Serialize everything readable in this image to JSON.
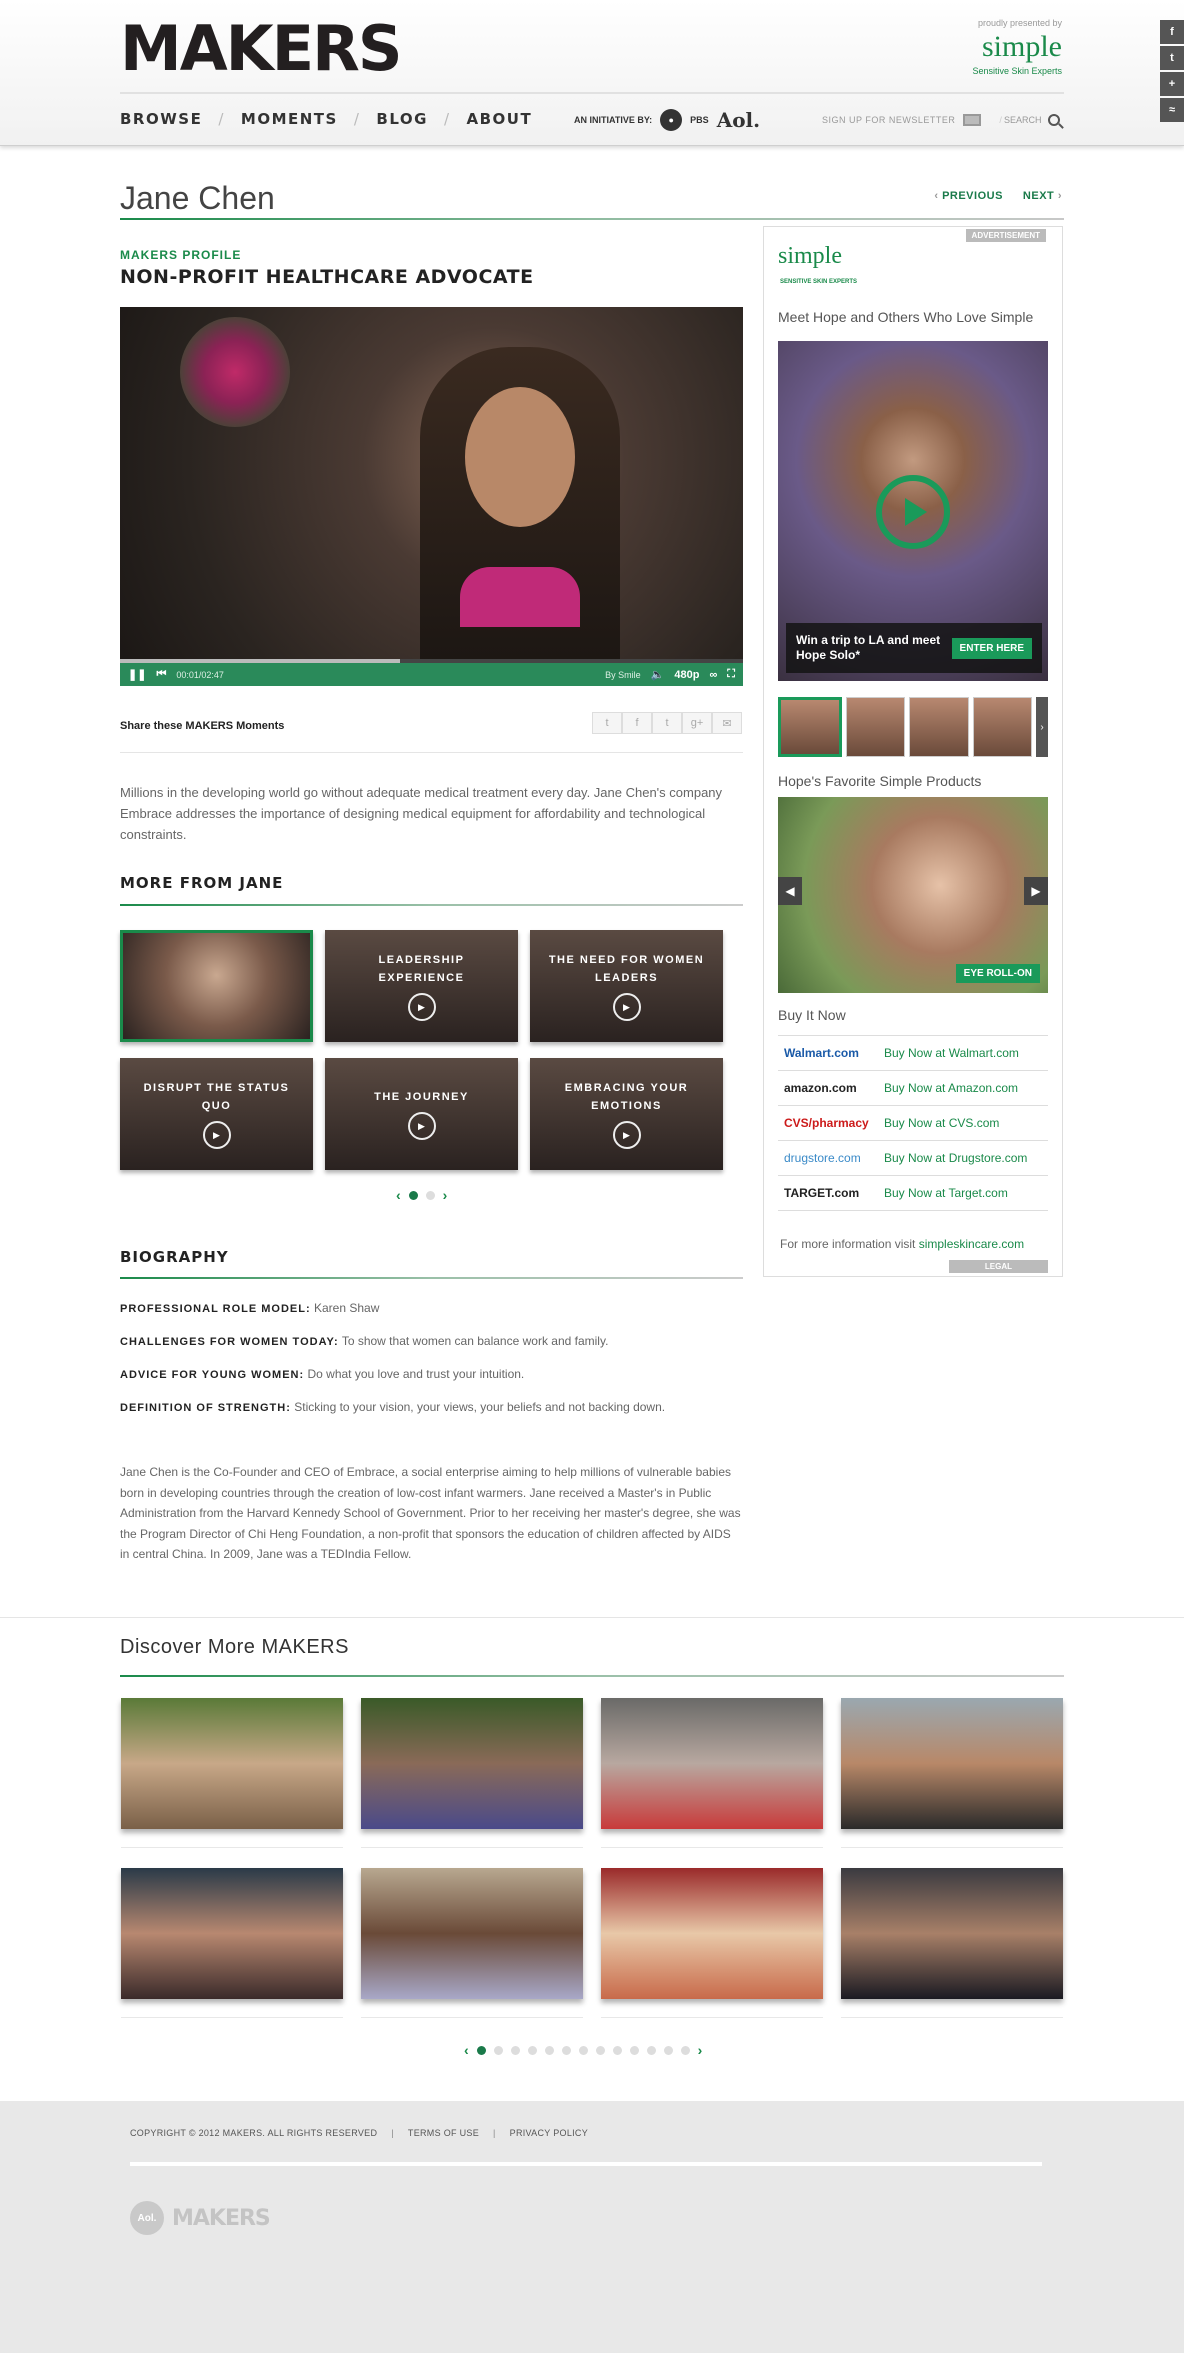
{
  "header": {
    "logo": "MAKERS",
    "presented_by": "proudly presented by",
    "sponsor_brand": "simple",
    "sponsor_tagline": "Sensitive Skin Experts",
    "nav": [
      "BROWSE",
      "MOMENTS",
      "BLOG",
      "ABOUT"
    ],
    "initiative_label": "AN INITIATIVE BY:",
    "pbs": "PBS",
    "aol": "Aol.",
    "newsletter": "SIGN UP FOR NEWSLETTER",
    "search": "SEARCH",
    "social_rail": [
      "f",
      "t",
      "+",
      "rss"
    ]
  },
  "profile": {
    "name": "Jane Chen",
    "previous": "PREVIOUS",
    "next": "NEXT",
    "kicker": "MAKERS PROFILE",
    "role": "NON-PROFIT HEALTHCARE ADVOCATE",
    "video": {
      "time": "00:01/02:47",
      "by": "By Smile",
      "quality": "480p"
    },
    "share_label": "Share these MAKERS Moments",
    "intro": "Millions in the developing world go without adequate medical treatment every day. Jane Chen's company Embrace addresses the importance of designing medical equipment for affordability and technological constraints."
  },
  "more_from": {
    "title": "MORE FROM JANE",
    "items": [
      "",
      "LEADERSHIP EXPERIENCE",
      "THE NEED FOR WOMEN LEADERS",
      "DISRUPT THE STATUS QUO",
      "THE JOURNEY",
      "EMBRACING YOUR EMOTIONS"
    ]
  },
  "biography": {
    "title": "BIOGRAPHY",
    "lines": [
      {
        "label": "PROFESSIONAL ROLE MODEL:",
        "value": "Karen Shaw"
      },
      {
        "label": "CHALLENGES FOR WOMEN TODAY:",
        "value": "To show that women can balance work and family."
      },
      {
        "label": "ADVICE FOR YOUNG WOMEN:",
        "value": "Do what you love and trust your intuition."
      },
      {
        "label": "DEFINITION OF STRENGTH:",
        "value": "Sticking to your vision, your views, your beliefs and not backing down."
      }
    ],
    "text": "Jane Chen is the Co-Founder and CEO of Embrace, a social enterprise aiming to help millions of vulnerable babies born in developing countries through the creation of low-cost infant warmers. Jane received a Master's in Public Administration from the Harvard Kennedy School of Government. Prior to her receiving her master's degree, she was the Program Director of Chi Heng Foundation, a non-profit that sponsors the education of children affected by AIDS in central China. In 2009, Jane was a TEDIndia Fellow."
  },
  "ad": {
    "tag": "ADVERTISEMENT",
    "brand": "simple",
    "brand_sub": "SENSITIVE SKIN EXPERTS",
    "headline": "Meet Hope and Others Who Love Simple",
    "promo_text": "Win a trip to LA and meet Hope Solo*",
    "promo_button": "ENTER HERE",
    "favorites_title": "Hope's Favorite Simple Products",
    "product_button": "EYE ROLL-ON",
    "buy_title": "Buy It Now",
    "retailers": [
      {
        "logo": "Walmart.com",
        "link": "Buy Now at Walmart.com",
        "color": "#1a5aa8"
      },
      {
        "logo": "amazon.com",
        "link": "Buy Now at Amazon.com",
        "color": "#222222"
      },
      {
        "logo": "CVS/pharmacy",
        "link": "Buy Now at CVS.com",
        "color": "#cc1a1a"
      },
      {
        "logo": "drugstore.com",
        "link": "Buy Now at Drugstore.com",
        "color": "#3a8ac8"
      },
      {
        "logo": "TARGET.com",
        "link": "Buy Now at Target.com",
        "color": "#222222"
      }
    ],
    "more_info": "For more information visit",
    "more_link": "simpleskincare.com",
    "legal": "LEGAL"
  },
  "discover": {
    "title": "Discover More MAKERS"
  },
  "footer": {
    "copyright": "COPYRIGHT © 2012 MAKERS. ALL RIGHTS RESERVED",
    "terms": "TERMS OF USE",
    "privacy": "PRIVACY POLICY",
    "aol": "Aol.",
    "logo": "MAKERS"
  },
  "colors": {
    "accent": "#1a8a4a",
    "footer_bg": "#e8e8e8"
  }
}
